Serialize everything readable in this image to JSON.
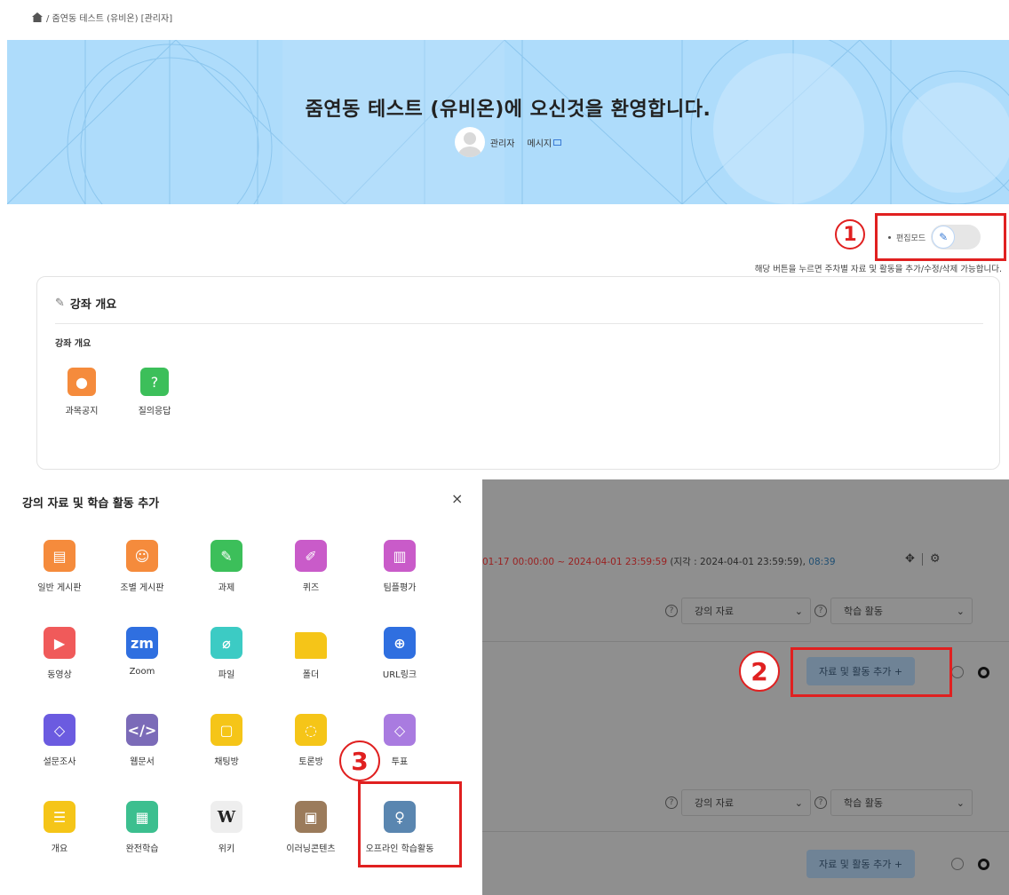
{
  "breadcrumb": {
    "text": "/ 줌연동 테스트 (유비온) [관리자]"
  },
  "banner": {
    "title": "줌연동 테스트 (유비온)에 오신것을 환영합니다.",
    "user_name": "관리자",
    "message_label": "메시지"
  },
  "editmode": {
    "label": "편집모드",
    "hint": "해당 버튼을 누르면 주차별 자료 및 활동을 추가/수정/삭제 가능합니다."
  },
  "annotations": {
    "one": "1",
    "two": "2",
    "three": "3"
  },
  "overview": {
    "title": "강좌 개요",
    "subtitle": "강좌 개요",
    "activities": [
      {
        "label": "과목공지",
        "icon": "microphone-icon",
        "color": "#f58b3c"
      },
      {
        "label": "질의응답",
        "icon": "question-icon",
        "color": "#3cbf5a"
      }
    ]
  },
  "week": {
    "dates_start": "01-17 00:00:00 ~ 2024-04-01 23:59:59",
    "dates_late": " (지각 : 2024-04-01 23:59:59), ",
    "duration": "08:39",
    "select_resource": "강의 자료",
    "select_activity": "학습 활동",
    "add_button": "자료 및 활동 추가 +"
  },
  "modal": {
    "title": "강의 자료 및 학습 활동 추가",
    "close": "×",
    "tiles": [
      {
        "label": "일반 게시판",
        "icon": "board-icon",
        "color": "#f58b3c",
        "glyph": "▤"
      },
      {
        "label": "조별 게시판",
        "icon": "group-board-icon",
        "color": "#f58b3c",
        "glyph": "☺"
      },
      {
        "label": "과제",
        "icon": "assignment-icon",
        "color": "#3cbf5a",
        "glyph": "✎"
      },
      {
        "label": "퀴즈",
        "icon": "quiz-icon",
        "color": "#c95bc9",
        "glyph": "✐"
      },
      {
        "label": "팀플평가",
        "icon": "team-eval-icon",
        "color": "#c95bc9",
        "glyph": "▥"
      },
      {
        "label": "동영상",
        "icon": "video-icon",
        "color": "#f05a5a",
        "glyph": "▶"
      },
      {
        "label": "Zoom",
        "icon": "zoom-icon",
        "color": "#2f6fe0",
        "glyph": "zm"
      },
      {
        "label": "파일",
        "icon": "file-icon",
        "color": "#3ccbc4",
        "glyph": "⌀"
      },
      {
        "label": "폴더",
        "icon": "folder-icon",
        "color": "#f5c518",
        "glyph": ""
      },
      {
        "label": "URL링크",
        "icon": "globe-icon",
        "color": "#2f6fe0",
        "glyph": "⊕"
      },
      {
        "label": "설문조사",
        "icon": "survey-icon",
        "color": "#6b5be0",
        "glyph": "◇"
      },
      {
        "label": "웹문서",
        "icon": "code-icon",
        "color": "#7b6bb8",
        "glyph": "</>"
      },
      {
        "label": "채팅방",
        "icon": "chat-icon",
        "color": "#f5c518",
        "glyph": "▢"
      },
      {
        "label": "토론방",
        "icon": "discussion-icon",
        "color": "#f5c518",
        "glyph": "◌"
      },
      {
        "label": "투표",
        "icon": "vote-icon",
        "color": "#a97be0",
        "glyph": "◇"
      },
      {
        "label": "개요",
        "icon": "list-icon",
        "color": "#f5c518",
        "glyph": "☰"
      },
      {
        "label": "완전학습",
        "icon": "grid-icon",
        "color": "#3cbf8f",
        "glyph": "▦"
      },
      {
        "label": "위키",
        "icon": "wiki-icon",
        "color": "#eeeeee",
        "glyph": "W"
      },
      {
        "label": "이러닝콘텐츠",
        "icon": "elearning-icon",
        "color": "#9b7b5b",
        "glyph": "▣"
      },
      {
        "label": "오프라인 학습활동",
        "icon": "offline-activity-icon",
        "color": "#5a86b0",
        "glyph": "♀"
      }
    ]
  }
}
